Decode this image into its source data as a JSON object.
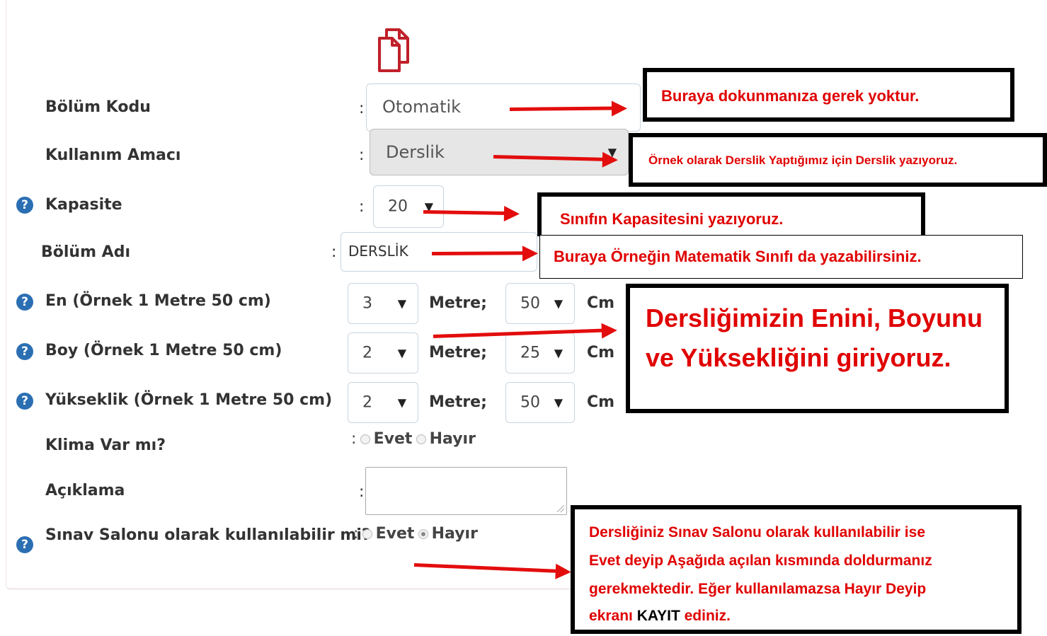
{
  "form": {
    "fields": {
      "bolum_kodu": {
        "label": "Bölüm Kodu",
        "value": "Otomatik"
      },
      "kullanim_amaci": {
        "label": "Kullanım Amacı",
        "value": "Derslik"
      },
      "kapasite": {
        "label": "Kapasite",
        "value": "20"
      },
      "bolum_adi": {
        "label": "Bölüm Adı",
        "value": "DERSLİK"
      },
      "en": {
        "label": "En (Örnek 1 Metre 50 cm)",
        "metre": "3",
        "cm": "50"
      },
      "boy": {
        "label": "Boy (Örnek 1 Metre 50 cm)",
        "metre": "2",
        "cm": "25"
      },
      "yukseklik": {
        "label": "Yükseklik (Örnek 1 Metre 50 cm)",
        "metre": "2",
        "cm": "50"
      },
      "klima": {
        "label": "Klima Var mı?",
        "option_yes": "Evet",
        "option_no": "Hayır"
      },
      "aciklama": {
        "label": "Açıklama",
        "value": ""
      },
      "sinav_salonu": {
        "label": "Sınav Salonu olarak kullanılabilir mi?",
        "option_yes": "Evet",
        "option_no": "Hayır",
        "selected": "Hayır"
      }
    },
    "colon": ":",
    "unit_metre": "Metre;",
    "unit_cm": "Cm",
    "help_glyph": "?",
    "caret_glyph": "▼",
    "copy_icon": "copy-icon"
  },
  "callouts": {
    "bolum_kodu": "Buraya dokunmanıza gerek yoktur.",
    "kullanim_amaci": "Örnek olarak Derslik Yaptığımız için Derslik yazıyoruz.",
    "kapasite": "Sınıfın Kapasitesini yazıyoruz.",
    "bolum_adi": "Buraya Örneğin Matematik Sınıfı da yazabilirsiniz.",
    "dimensions_line1": "Dersliğimizin Enini, Boyunu",
    "dimensions_line2": "ve Yüksekliğini giriyoruz.",
    "sinav_line1": "Dersliğiniz Sınav Salonu olarak kullanılabilir ise",
    "sinav_line2": "Evet deyip Aşağıda açılan kısmında doldurmanız",
    "sinav_line3": "gerekmektedir. Eğer kullanılamazsa Hayır Deyip",
    "sinav_line4_pre": "ekranı ",
    "sinav_line4_kayit": "KAYIT",
    "sinav_line4_post": " ediniz."
  },
  "colors": {
    "annotation_red": "#e30d0d",
    "help_blue": "#2b6fb3",
    "copy_icon_red": "#c0202a"
  }
}
